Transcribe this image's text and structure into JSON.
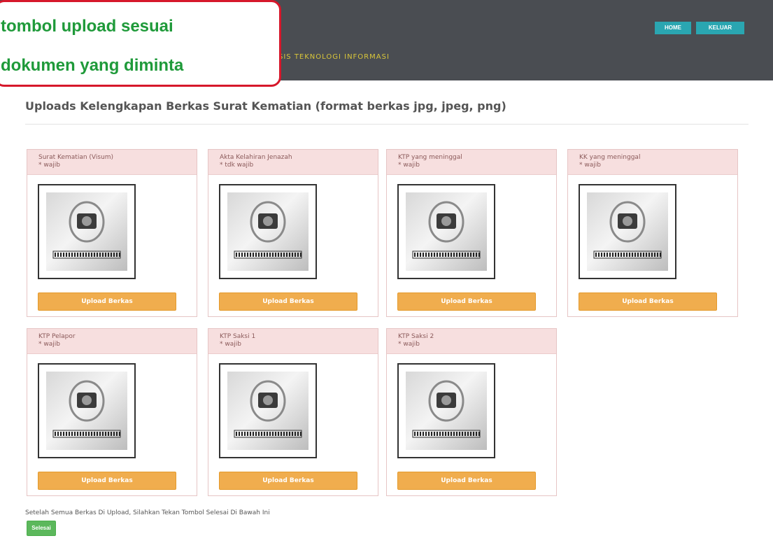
{
  "header": {
    "subtitle": "SIS TEKNOLOGI INFORMASI",
    "nav": {
      "home": "HOME",
      "keluar": "KELUAR"
    }
  },
  "callout": {
    "line1": "tombol upload sesuai",
    "line2": "dokumen yang diminta",
    "border_color": "#d6182b",
    "text_color": "#1f9a3a"
  },
  "page": {
    "title": "Uploads Kelengkapan Berkas Surat Kematian (format berkas jpg, jpeg, png)"
  },
  "documents": [
    {
      "title": "Surat Kematian (Visum)",
      "requirement": "* wajib",
      "button": "Upload Berkas",
      "thumb_icon": "camera-placeholder-icon"
    },
    {
      "title": "Akta Kelahiran Jenazah",
      "requirement": "* tdk wajib",
      "button": "Upload Berkas",
      "thumb_icon": "camera-placeholder-icon"
    },
    {
      "title": "KTP yang meninggal",
      "requirement": "* wajib",
      "button": "Upload Berkas",
      "thumb_icon": "camera-placeholder-icon"
    },
    {
      "title": "KK yang meninggal",
      "requirement": "* wajib",
      "button": "Upload Berkas",
      "thumb_icon": "camera-placeholder-icon"
    },
    {
      "title": "KTP Pelapor",
      "requirement": "* wajib",
      "button": "Upload Berkas",
      "thumb_icon": "camera-placeholder-icon"
    },
    {
      "title": "KTP Saksi 1",
      "requirement": "* wajib",
      "button": "Upload Berkas",
      "thumb_icon": "camera-placeholder-icon"
    },
    {
      "title": "KTP Saksi 2",
      "requirement": "* wajib",
      "button": "Upload Berkas",
      "thumb_icon": "camera-placeholder-icon"
    }
  ],
  "footer": {
    "instruction": "Setelah Semua Berkas Di Upload, Silahkan Tekan Tombol Selesai Di Bawah Ini",
    "finish_button": "Selesai"
  },
  "colors": {
    "topbar": "#4a4d52",
    "nav_button": "#2aa6b1",
    "upload_button": "#f0ad4e",
    "finish_button": "#5cb85c",
    "card_header": "#f7dfdf"
  }
}
